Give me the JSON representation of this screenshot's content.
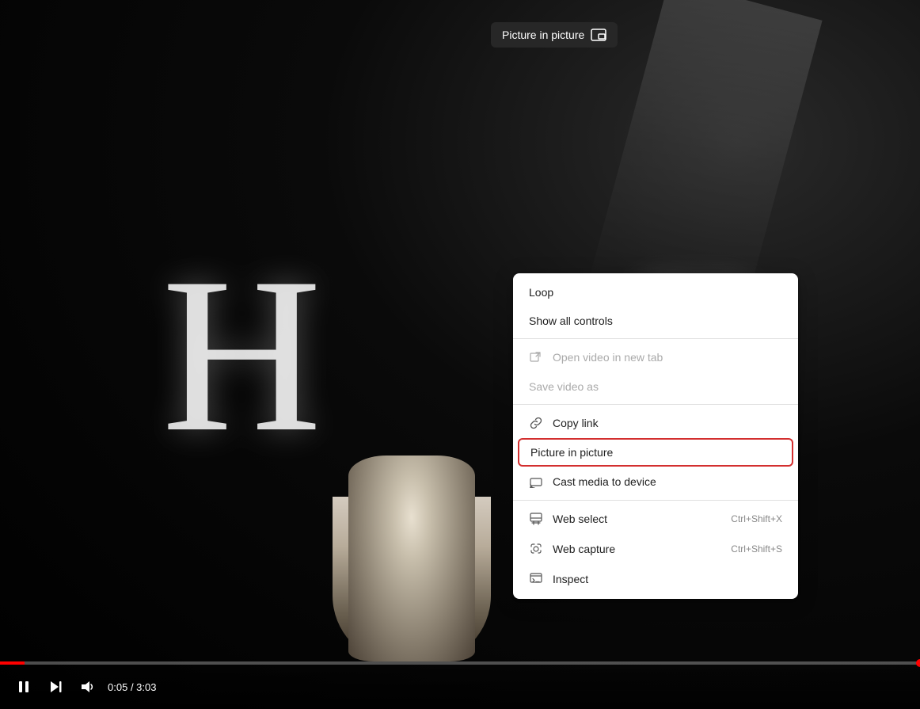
{
  "video": {
    "current_time": "0:05",
    "total_time": "3:03",
    "progress_percent": 2.7
  },
  "pip_tooltip": {
    "label": "Picture in picture"
  },
  "context_menu": {
    "items": [
      {
        "id": "loop",
        "label": "Loop",
        "icon": null,
        "shortcut": null,
        "disabled": false,
        "separator_after": false
      },
      {
        "id": "show-controls",
        "label": "Show all controls",
        "icon": null,
        "shortcut": null,
        "disabled": false,
        "separator_after": true
      },
      {
        "id": "open-new-tab",
        "label": "Open video in new tab",
        "icon": "newtab",
        "shortcut": null,
        "disabled": true,
        "separator_after": false
      },
      {
        "id": "save-video",
        "label": "Save video as",
        "icon": null,
        "shortcut": null,
        "disabled": true,
        "separator_after": false
      },
      {
        "id": "copy-link",
        "label": "Copy link",
        "icon": "link",
        "shortcut": null,
        "disabled": false,
        "separator_after": false
      },
      {
        "id": "picture-in-picture",
        "label": "Picture in picture",
        "icon": null,
        "shortcut": null,
        "disabled": false,
        "highlighted": true,
        "separator_after": false
      },
      {
        "id": "cast-media",
        "label": "Cast media to device",
        "icon": "cast",
        "shortcut": null,
        "disabled": false,
        "separator_after": false
      },
      {
        "id": "web-select",
        "label": "Web select",
        "icon": "webselect",
        "shortcut": "Ctrl+Shift+X",
        "disabled": false,
        "separator_after": false
      },
      {
        "id": "web-capture",
        "label": "Web capture",
        "icon": "webcapture",
        "shortcut": "Ctrl+Shift+S",
        "disabled": false,
        "separator_after": false
      },
      {
        "id": "inspect",
        "label": "Inspect",
        "icon": "inspect",
        "shortcut": null,
        "disabled": false,
        "separator_after": false
      }
    ]
  },
  "controls": {
    "play_pause": "pause",
    "skip_next": "skip",
    "volume": "volume"
  }
}
